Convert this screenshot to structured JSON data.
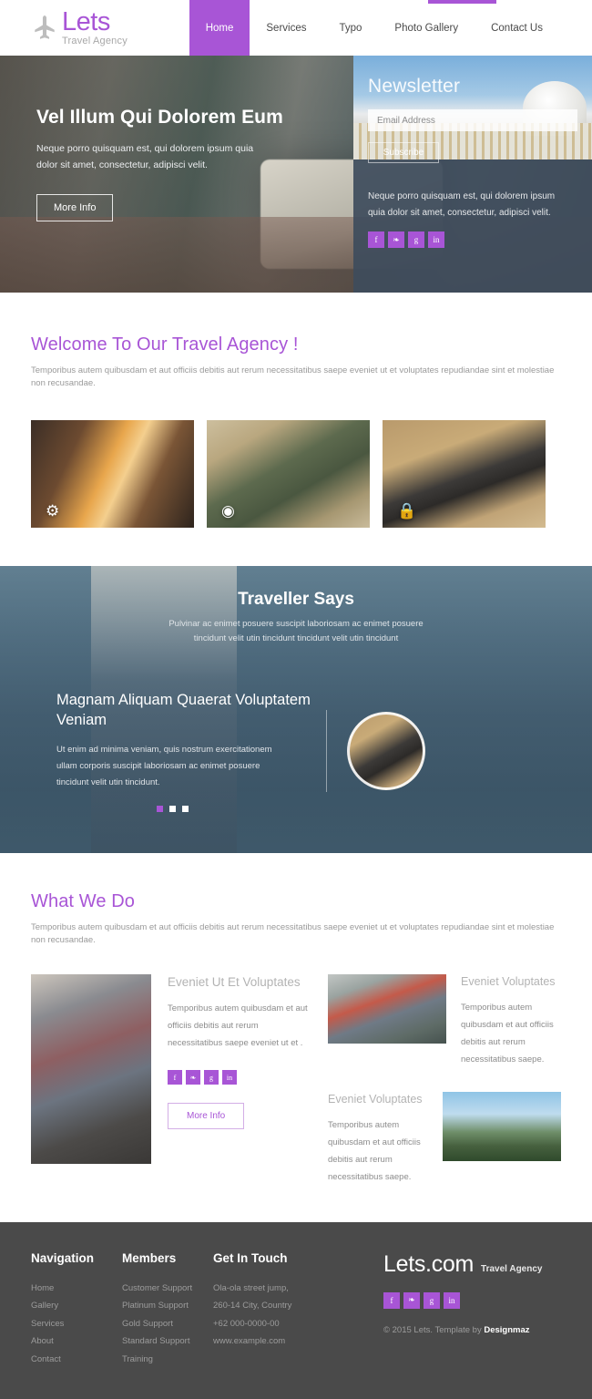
{
  "header": {
    "brand_name": "Lets",
    "brand_sub": "Travel Agency",
    "logo_icon": "airplane-icon",
    "nav": [
      {
        "label": "Home",
        "active": true
      },
      {
        "label": "Services",
        "active": false
      },
      {
        "label": "Typo",
        "active": false
      },
      {
        "label": "Photo Gallery",
        "active": false
      },
      {
        "label": "Contact Us",
        "active": false
      }
    ]
  },
  "hero": {
    "title": "Vel Illum Qui Dolorem Eum",
    "desc": "Neque porro quisquam est, qui dolorem ipsum quia dolor sit amet, consectetur, adipisci velit.",
    "button": "More Info"
  },
  "newsletter": {
    "title": "Newsletter",
    "email_placeholder": "Email Address",
    "email_value": "",
    "subscribe_label": "Subscribe",
    "desc": "Neque porro quisquam est, qui dolorem ipsum quia dolor sit amet, consectetur, adipisci velit.",
    "socials": [
      {
        "name": "facebook-icon",
        "glyph": "f"
      },
      {
        "name": "twitter-icon",
        "glyph": "❧"
      },
      {
        "name": "google-plus-icon",
        "glyph": "g"
      },
      {
        "name": "linkedin-icon",
        "glyph": "in"
      }
    ]
  },
  "welcome": {
    "title": "Welcome To Our Travel Agency !",
    "subtitle": "Temporibus autem quibusdam et aut officiis debitis aut rerum necessitatibus saepe eveniet ut et voluptates repudiandae sint et molestiae non recusandae.",
    "cards": [
      {
        "icon_name": "gear-icon",
        "glyph": "⚙"
      },
      {
        "icon_name": "eye-icon",
        "glyph": "◉"
      },
      {
        "icon_name": "lock-icon",
        "glyph": "ὑ2"
      }
    ]
  },
  "testimonial": {
    "title": "Traveller Says",
    "subtitle": "Pulvinar ac enimet posuere suscipit laboriosam ac enimet posuere tincidunt velit utin tincidunt tincidunt velit utin tincidunt",
    "quote_title": "Magnam Aliquam Quaerat Voluptatem Veniam",
    "quote": "Ut enim ad minima veniam, quis nostrum exercitationem ullam corporis suscipit laboriosam ac enimet posuere tincidunt velit utin tincidunt.",
    "dots": [
      {
        "active": true
      },
      {
        "active": false
      },
      {
        "active": false
      }
    ]
  },
  "what_we_do": {
    "title": "What We Do",
    "subtitle": "Temporibus autem quibusdam et aut officiis debitis aut rerum necessitatibus saepe eveniet ut et voluptates repudiandae sint et molestiae non recusandae.",
    "main": {
      "heading": "Eveniet Ut Et Voluptates",
      "text": "Temporibus autem quibusdam et aut officiis debitis aut rerum necessitatibus saepe eveniet ut et .",
      "button": "More Info",
      "image_name": "luggage-photo"
    },
    "items": [
      {
        "heading": "Eveniet Voluptates",
        "text": "Temporibus autem quibusdam et aut officiis debitis aut rerum necessitatibus saepe.",
        "image_name": "street-market-photo"
      },
      {
        "heading": "Eveniet Voluptates",
        "text": "Temporibus autem quibusdam et aut officiis debitis aut rerum necessitatibus saepe.",
        "image_name": "mountain-hiker-photo"
      }
    ]
  },
  "footer": {
    "navigation": {
      "heading": "Navigation",
      "items": [
        "Home",
        "Gallery",
        "Services",
        "About",
        "Contact"
      ]
    },
    "members": {
      "heading": "Members",
      "items": [
        "Customer Support",
        "Platinum Support",
        "Gold Support",
        "Standard Support",
        "Training"
      ]
    },
    "touch": {
      "heading": "Get In Touch",
      "items": [
        "Ola-ola street jump,",
        "260-14 City, Country",
        "+62 000-0000-00",
        "www.example.com"
      ]
    },
    "brand_name": "Lets.com",
    "brand_sub": "Travel Agency",
    "copyright_prefix": "© 2015 Lets. Template by ",
    "copyright_author": "Designmaz",
    "socials": [
      {
        "name": "facebook-icon",
        "glyph": "f"
      },
      {
        "name": "twitter-icon",
        "glyph": "❧"
      },
      {
        "name": "google-plus-icon",
        "glyph": "g"
      },
      {
        "name": "linkedin-icon",
        "glyph": "in"
      }
    ]
  },
  "colors": {
    "accent": "#a855d6",
    "footer_bg": "#4a4a4a",
    "dark_panel": "#3e4c5c"
  }
}
